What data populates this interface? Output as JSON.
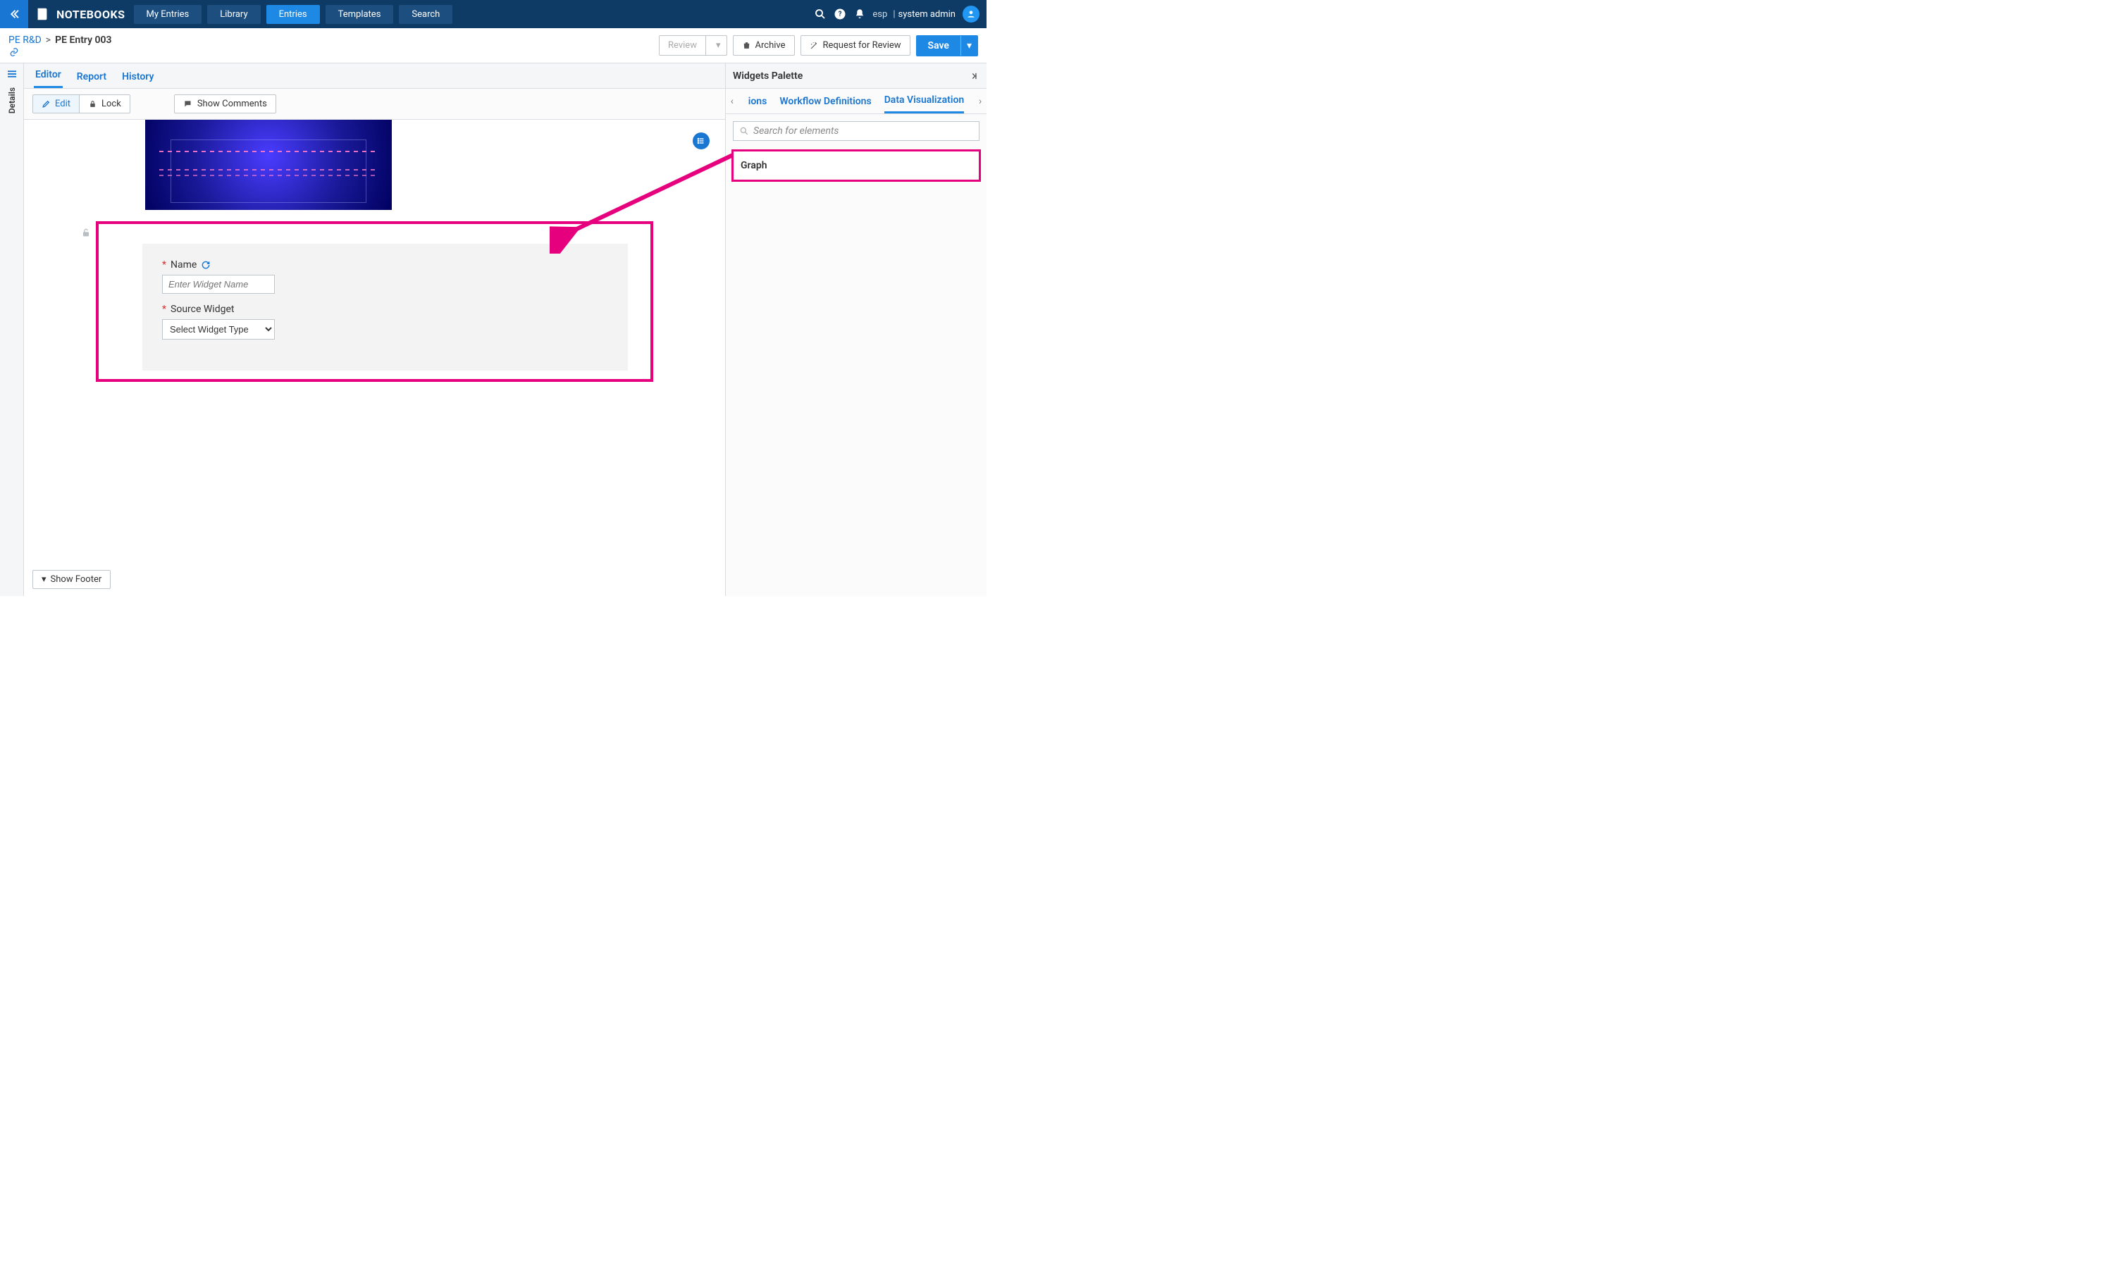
{
  "header": {
    "app_title": "NOTEBOOKS",
    "nav": [
      {
        "label": "My Entries",
        "active": false
      },
      {
        "label": "Library",
        "active": false
      },
      {
        "label": "Entries",
        "active": true
      },
      {
        "label": "Templates",
        "active": false
      },
      {
        "label": "Search",
        "active": false
      }
    ],
    "user_short": "esp",
    "user_role": "system admin"
  },
  "breadcrumb": {
    "parent": "PE R&D",
    "sep": ">",
    "current": "PE Entry 003"
  },
  "actions": {
    "review": "Review",
    "archive": "Archive",
    "request_review": "Request for Review",
    "save": "Save"
  },
  "details_label": "Details",
  "main_tabs": [
    {
      "label": "Editor",
      "active": true
    },
    {
      "label": "Report",
      "active": false
    },
    {
      "label": "History",
      "active": false
    }
  ],
  "toolbar": {
    "edit": "Edit",
    "lock": "Lock",
    "show_comments": "Show Comments",
    "show_footer": "Show Footer"
  },
  "widget_form": {
    "name_label": "Name",
    "name_placeholder": "Enter Widget Name",
    "source_label": "Source Widget",
    "source_placeholder": "Select Widget Type"
  },
  "palette": {
    "title": "Widgets Palette",
    "tabs_overflow": "ions",
    "tab_workflow": "Workflow Definitions",
    "tab_dataviz": "Data Visualization",
    "search_placeholder": "Search for elements",
    "items": [
      {
        "label": "Graph"
      }
    ]
  }
}
